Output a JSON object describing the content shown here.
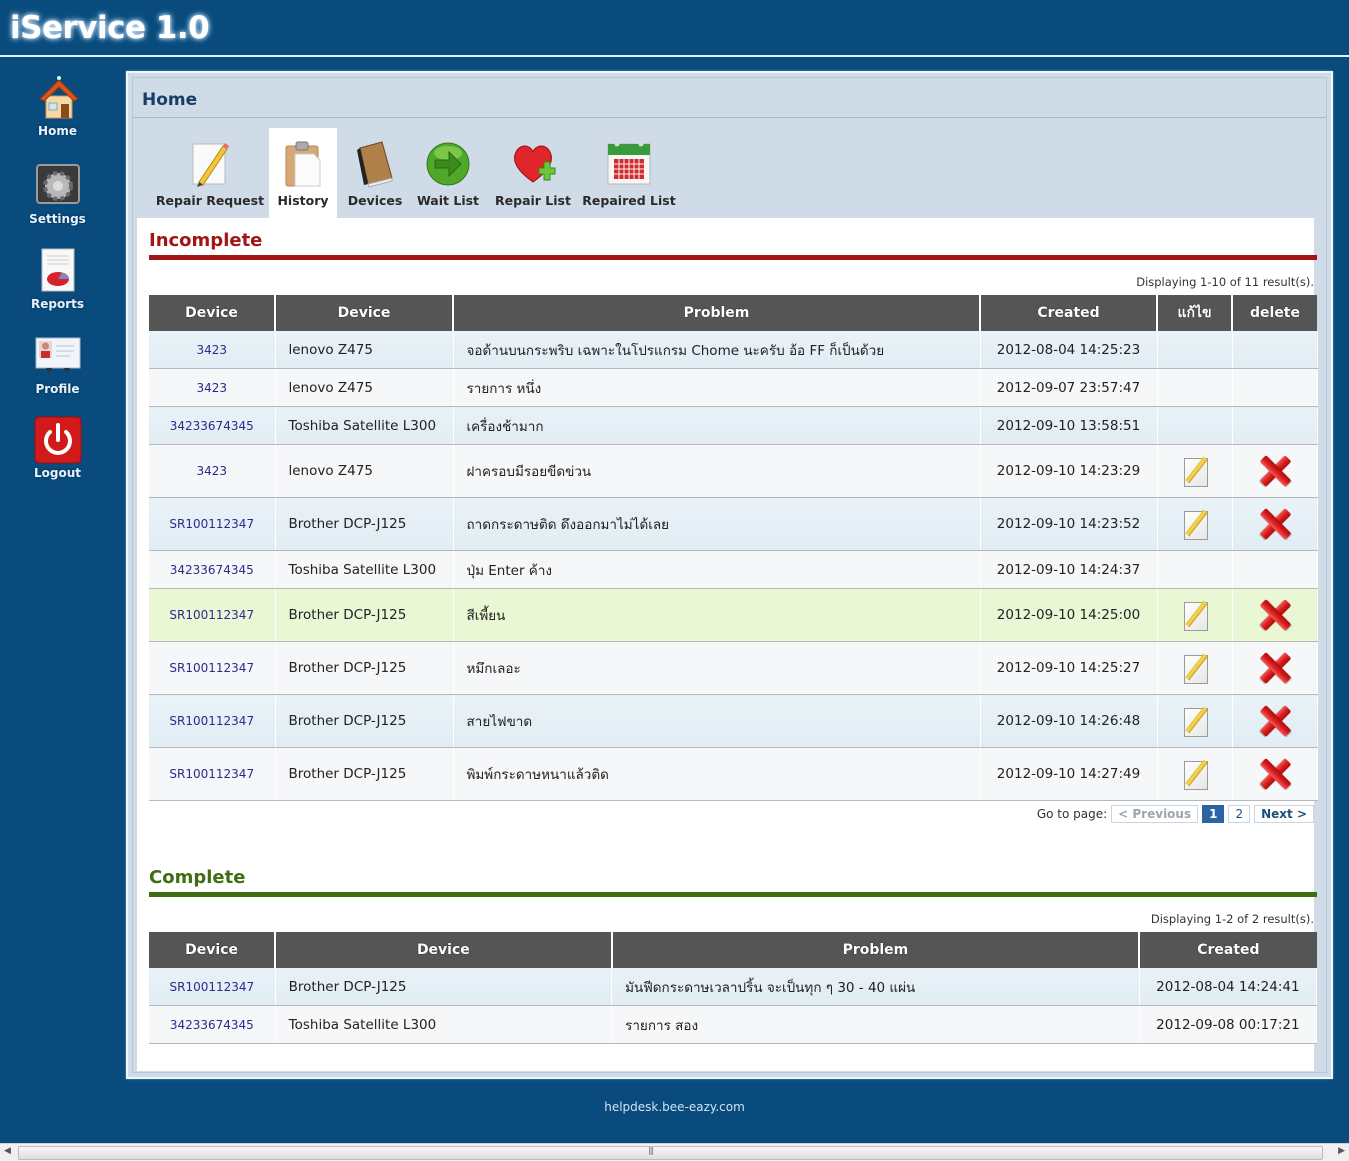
{
  "app": {
    "title": "iService 1.0"
  },
  "sidebar": {
    "items": [
      {
        "label": "Home",
        "icon": "house-icon"
      },
      {
        "label": "Settings",
        "icon": "gear-icon"
      },
      {
        "label": "Reports",
        "icon": "report-pie-icon"
      },
      {
        "label": "Profile",
        "icon": "id-card-icon"
      },
      {
        "label": "Logout",
        "icon": "power-icon"
      }
    ]
  },
  "header": {
    "title": "Home"
  },
  "toolbar": {
    "active": "History",
    "items": [
      {
        "label": "Repair Request",
        "icon": "pencil-paper-icon"
      },
      {
        "label": "History",
        "icon": "clipboard-icon"
      },
      {
        "label": "Devices",
        "icon": "book-icon"
      },
      {
        "label": "Wait List",
        "icon": "green-arrow-icon"
      },
      {
        "label": "Repair List",
        "icon": "heart-plus-icon"
      },
      {
        "label": "Repaired List",
        "icon": "calendar-icon"
      }
    ]
  },
  "incomplete": {
    "title": "Incomplete",
    "accent": "#a31515",
    "result_info": "Displaying 1-10 of 11 result(s).",
    "columns": [
      "Device",
      "Device",
      "Problem",
      "Created",
      "แก้ไข",
      "delete"
    ],
    "rows": [
      {
        "id": "3423",
        "device": "lenovo Z475",
        "problem": "จอด้านบนกระพริบ เฉพาะในโปรแกรม Chome นะครับ อ้อ FF ก็เป็นด้วย",
        "created": "2012-08-04 14:25:23",
        "actions": false
      },
      {
        "id": "3423",
        "device": "lenovo Z475",
        "problem": "รายการ หนึ่ง",
        "created": "2012-09-07 23:57:47",
        "actions": false
      },
      {
        "id": "34233674345",
        "device": "Toshiba Satellite L300",
        "problem": "เครื่องช้ามาก",
        "created": "2012-09-10 13:58:51",
        "actions": false
      },
      {
        "id": "3423",
        "device": "lenovo Z475",
        "problem": "ฝาครอบมีรอยขีดข่วน",
        "created": "2012-09-10 14:23:29",
        "actions": true
      },
      {
        "id": "SR100112347",
        "device": "Brother DCP-J125",
        "problem": "ถาดกระดาษติด ดึงออกมาไม่ได้เลย",
        "created": "2012-09-10 14:23:52",
        "actions": true
      },
      {
        "id": "34233674345",
        "device": "Toshiba Satellite L300",
        "problem": "ปุ่ม Enter ค้าง",
        "created": "2012-09-10 14:24:37",
        "actions": false
      },
      {
        "id": "SR100112347",
        "device": "Brother DCP-J125",
        "problem": "สีเพี้ยน",
        "created": "2012-09-10 14:25:00",
        "actions": true,
        "highlighted": true
      },
      {
        "id": "SR100112347",
        "device": "Brother DCP-J125",
        "problem": "หมึกเลอะ",
        "created": "2012-09-10 14:25:27",
        "actions": true
      },
      {
        "id": "SR100112347",
        "device": "Brother DCP-J125",
        "problem": "สายไฟขาด",
        "created": "2012-09-10 14:26:48",
        "actions": true
      },
      {
        "id": "SR100112347",
        "device": "Brother DCP-J125",
        "problem": "พิมพ์กระดาษหนาแล้วติด",
        "created": "2012-09-10 14:27:49",
        "actions": true
      }
    ],
    "pager": {
      "label": "Go to page:",
      "previous": "< Previous",
      "pages": [
        "1",
        "2"
      ],
      "current": "1",
      "next": "Next >"
    }
  },
  "complete": {
    "title": "Complete",
    "accent": "#3f6d12",
    "result_info": "Displaying 1-2 of 2 result(s).",
    "columns": [
      "Device",
      "Device",
      "Problem",
      "Created"
    ],
    "rows": [
      {
        "id": "SR100112347",
        "device": "Brother DCP-J125",
        "problem": "มันฟีดกระดาษเวลาปริ้น จะเป็นทุก ๆ 30 - 40 แผ่น",
        "created": "2012-08-04 14:24:41"
      },
      {
        "id": "34233674345",
        "device": "Toshiba Satellite L300",
        "problem": "รายการ สอง",
        "created": "2012-09-08 00:17:21"
      }
    ]
  },
  "footer": {
    "text": "helpdesk.bee-eazy.com"
  }
}
